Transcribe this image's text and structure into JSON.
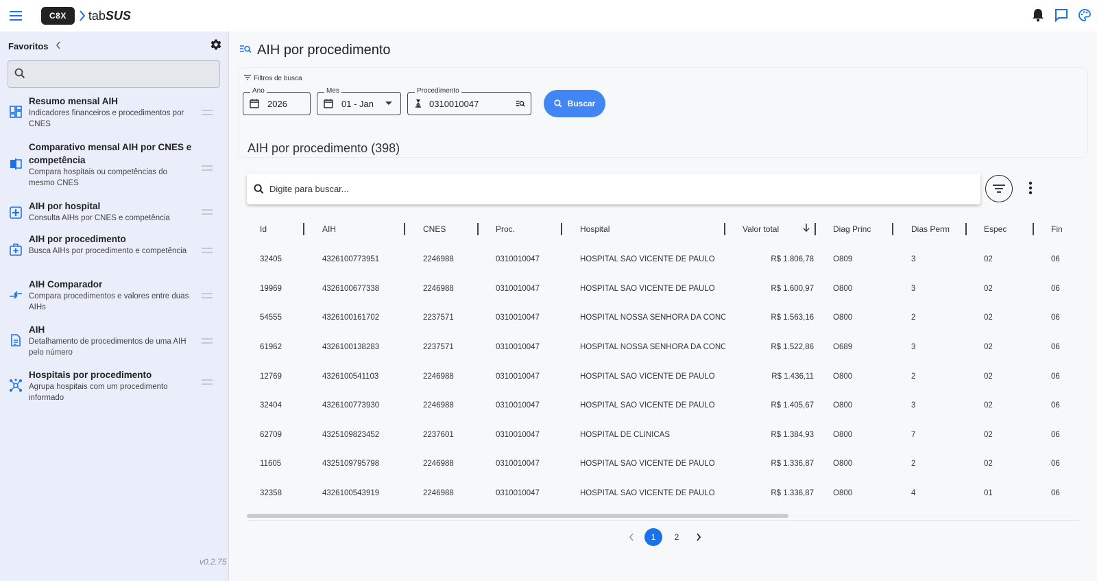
{
  "header": {
    "logo_box": "C8X",
    "logo_tab": "tab",
    "logo_sus": "SUS",
    "icons": [
      "menu-icon",
      "bell-icon",
      "chat-icon",
      "palette-icon"
    ]
  },
  "sidebar": {
    "favorites_label": "Favoritos",
    "version": "v0.2.75",
    "items": [
      {
        "title": "Resumo mensal AIH",
        "desc": "Indicadores financeiros e procedimentos por CNES",
        "icon": "dashboard-icon"
      },
      {
        "title": "Comparativo mensal AIH por CNES e competência",
        "desc": "Compara hospitais ou competências do mesmo CNES",
        "icon": "compare-icon"
      },
      {
        "title": "AIH por hospital",
        "desc": "Consulta AIHs por CNES e competência",
        "icon": "hospital-icon"
      },
      {
        "title": "AIH por procedimento",
        "desc": "Busca AIHs por procedimento e competência",
        "icon": "procedure-icon"
      },
      {
        "title": "AIH Comparador",
        "desc": "Compara procedimentos e valores entre duas AIHs",
        "icon": "compare-arrows-icon"
      },
      {
        "title": "AIH",
        "desc": "Detalhamento de procedimentos de uma AIH pelo número",
        "icon": "document-icon"
      },
      {
        "title": "Hospitais por procedimento",
        "desc": "Agrupa hospitais com um procedimento informado",
        "icon": "hub-icon"
      }
    ]
  },
  "main": {
    "title": "AIH por procedimento",
    "filters_label": "Filtros de busca",
    "ano_label": "Ano",
    "ano_value": "2026",
    "mes_label": "Mes",
    "mes_value": "01 - Jan",
    "proc_label": "Procedimento",
    "proc_value": "0310010047",
    "buscar_label": "Buscar",
    "results_title": "AIH por procedimento (398)",
    "search_placeholder": "Digite para buscar..."
  },
  "table": {
    "columns": [
      "Id",
      "AIH",
      "CNES",
      "Proc.",
      "Hospital",
      "Valor total",
      "Diag Princ",
      "Dias Perm",
      "Espec",
      "Fin"
    ],
    "rows": [
      [
        "32405",
        "4326100773951",
        "2246988",
        "0310010047",
        "HOSPITAL SAO VICENTE DE PAULO",
        "R$ 1.806,78",
        "O809",
        "3",
        "02",
        "06"
      ],
      [
        "19969",
        "4326100677338",
        "2246988",
        "0310010047",
        "HOSPITAL SAO VICENTE DE PAULO",
        "R$ 1.600,97",
        "O800",
        "3",
        "02",
        "06"
      ],
      [
        "54555",
        "4326100161702",
        "2237571",
        "0310010047",
        "HOSPITAL NOSSA SENHORA DA CONCEI",
        "R$ 1.563,16",
        "O800",
        "2",
        "02",
        "06"
      ],
      [
        "61962",
        "4326100138283",
        "2237571",
        "0310010047",
        "HOSPITAL NOSSA SENHORA DA CONCEI",
        "R$ 1.522,86",
        "O689",
        "3",
        "02",
        "06"
      ],
      [
        "12769",
        "4326100541103",
        "2246988",
        "0310010047",
        "HOSPITAL SAO VICENTE DE PAULO",
        "R$ 1.436,11",
        "O800",
        "2",
        "02",
        "06"
      ],
      [
        "32404",
        "4326100773930",
        "2246988",
        "0310010047",
        "HOSPITAL SAO VICENTE DE PAULO",
        "R$ 1.405,67",
        "O800",
        "3",
        "02",
        "06"
      ],
      [
        "62709",
        "4325109823452",
        "2237601",
        "0310010047",
        "HOSPITAL DE CLINICAS",
        "R$ 1.384,93",
        "O800",
        "7",
        "02",
        "06"
      ],
      [
        "11605",
        "4325109795798",
        "2246988",
        "0310010047",
        "HOSPITAL SAO VICENTE DE PAULO",
        "R$ 1.336,87",
        "O800",
        "2",
        "02",
        "06"
      ],
      [
        "32358",
        "4326100543919",
        "2246988",
        "0310010047",
        "HOSPITAL SAO VICENTE DE PAULO",
        "R$ 1.336,87",
        "O800",
        "4",
        "01",
        "06"
      ]
    ]
  },
  "pagination": {
    "pages": [
      "1",
      "2"
    ],
    "current": "1"
  },
  "colors": {
    "accent": "#1a73e8",
    "button": "#4285f4",
    "sidebar_bg": "#e9eefa",
    "icon_blue": "#1a73e8"
  }
}
